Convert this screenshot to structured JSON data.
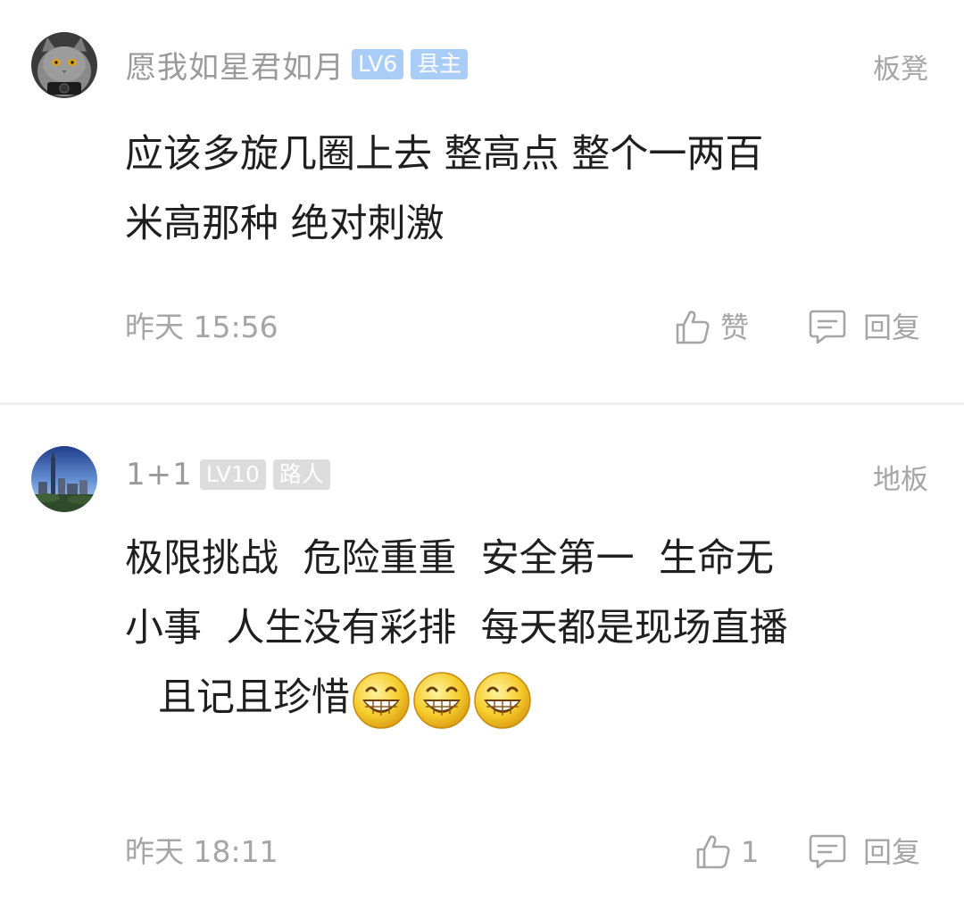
{
  "comments": [
    {
      "username": "愿我如星君如月",
      "level_badge": "LV6",
      "title_badge": "县主",
      "floor": "板凳",
      "content_lines": [
        "应该多旋几圈上去 整高点 整个一两百",
        "米高那种 绝对刺激"
      ],
      "time": "昨天 15:56",
      "like_label": "赞",
      "reply_label": "回复",
      "avatar_icon": "cat-avatar-icon",
      "badge_color": "#a9cdf6"
    },
    {
      "username": "1+1",
      "level_badge": "LV10",
      "title_badge": "路人",
      "floor": "地板",
      "content_lines": [
        "极限挑战  危险重重  安全第一  生命无",
        "小事  人生没有彩排  每天都是现场直播",
        "且记且珍惜"
      ],
      "emoji_count": 3,
      "emoji_icon": "grin-emoji-icon",
      "time": "昨天 18:11",
      "like_label": "1",
      "reply_label": "回复",
      "avatar_icon": "city-skyline-avatar-icon",
      "badge_color": "#dcdcdc"
    }
  ],
  "colors": {
    "meta_text": "#a5a5a5",
    "body_text": "#1f1f1f",
    "separator": "#efefef"
  }
}
